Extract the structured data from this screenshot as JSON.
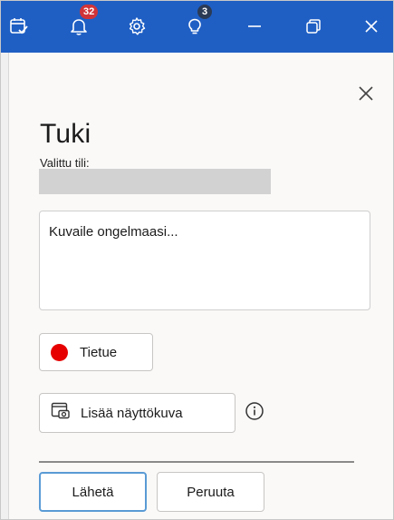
{
  "titlebar": {
    "notifications_badge": "32",
    "tips_badge": "3",
    "icons": [
      "calendar-check-icon",
      "bell-icon",
      "gear-icon",
      "lightbulb-icon",
      "minimize-icon",
      "restore-icon",
      "close-icon"
    ],
    "colors": {
      "bar": "#1f5fc4",
      "badge_red": "#d13438",
      "badge_dark": "#2b3a55"
    }
  },
  "panel": {
    "title": "Tuki",
    "account_label": "Valittu tili:",
    "description_placeholder": "Kuvaile ongelmaasi...",
    "record_label": "Tietue",
    "screenshot_label": "Lisää näyttökuva",
    "send_label": "Lähetä",
    "cancel_label": "Peruuta",
    "colors": {
      "record_dot": "#e60000",
      "send_border": "#5a9bd5"
    }
  }
}
